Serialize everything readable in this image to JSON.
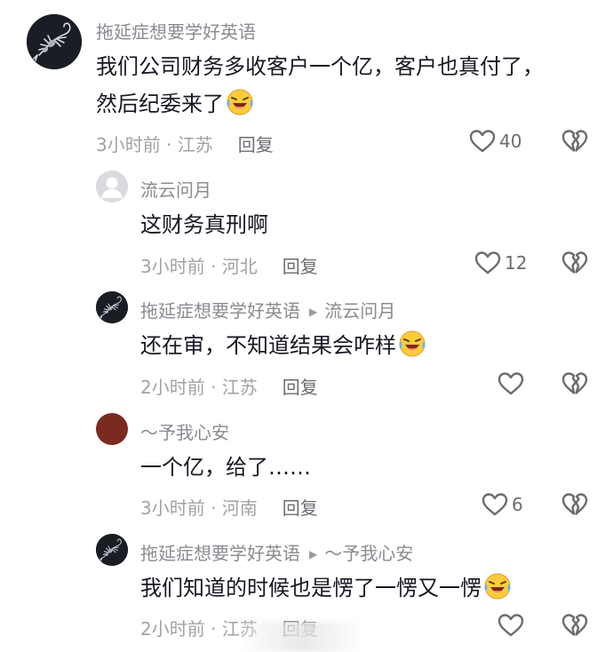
{
  "comments": [
    {
      "user": "拖延症想要学好英语",
      "text_line1": "我们公司财务多收客户一个亿，客户也真付了，",
      "text_line2": "然后纪委来了",
      "time": "3小时前 · 江苏",
      "reply_label": "回复",
      "likes": "40",
      "avatar_icon": "scorpion-avatar-icon"
    },
    {
      "user": "流云问月",
      "text": "这财务真刑啊",
      "time": "3小时前 · 河北",
      "reply_label": "回复",
      "likes": "12",
      "avatar_icon": "default-user-avatar-icon"
    },
    {
      "user": "拖延症想要学好英语",
      "reply_to": "流云问月",
      "text": "还在审，不知道结果会咋样",
      "time": "2小时前 · 江苏",
      "reply_label": "回复",
      "likes": "",
      "avatar_icon": "scorpion-avatar-icon"
    },
    {
      "user": "～予我心安",
      "text": "一个亿，给了……",
      "time": "3小时前 · 河南",
      "reply_label": "回复",
      "likes": "6",
      "avatar_icon": "red-book-avatar-icon"
    },
    {
      "user": "拖延症想要学好英语",
      "reply_to": "～予我心安",
      "text": "我们知道的时候也是愣了一愣又一愣",
      "time": "2小时前 · 江苏",
      "reply_label": "回复",
      "likes": "",
      "avatar_icon": "scorpion-avatar-icon"
    }
  ],
  "icons": {
    "like": "heart-outline-icon",
    "dislike": "broken-heart-icon",
    "emoji": "laughing-crying-emoji-icon"
  }
}
